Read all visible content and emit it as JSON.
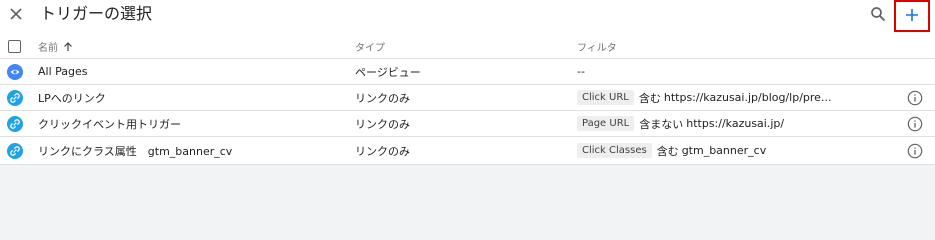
{
  "header": {
    "title": "トリガーの選択",
    "close_icon": "close-icon",
    "search_icon": "search-icon",
    "add_icon": "plus-icon"
  },
  "table": {
    "columns": {
      "name": "名前",
      "type": "タイプ",
      "filter": "フィルタ"
    },
    "rows": [
      {
        "icon": "eye-icon",
        "icon_color": "#4285f4",
        "name": "All Pages",
        "type": "ページビュー",
        "filter_none": "--"
      },
      {
        "icon": "link-icon",
        "icon_color": "#1fa3e6",
        "name": "LPへのリンク",
        "type": "リンクのみ",
        "filter_var": "Click URL",
        "filter_op": "含む",
        "filter_value": "https://kazusai.jp/blog/lp/pre..."
      },
      {
        "icon": "link-icon",
        "icon_color": "#1fa3e6",
        "name": "クリックイベント用トリガー",
        "type": "リンクのみ",
        "filter_var": "Page URL",
        "filter_op": "含まない",
        "filter_value": "https://kazusai.jp/"
      },
      {
        "icon": "link-icon",
        "icon_color": "#1fa3e6",
        "name": "リンクにクラス属性　gtm_banner_cv",
        "type": "リンクのみ",
        "filter_var": "Click Classes",
        "filter_op": "含む",
        "filter_value": "gtm_banner_cv"
      }
    ]
  },
  "colors": {
    "accent_blue": "#1a73e8",
    "highlight_red": "#e00000",
    "background": "#f2f3f5"
  }
}
